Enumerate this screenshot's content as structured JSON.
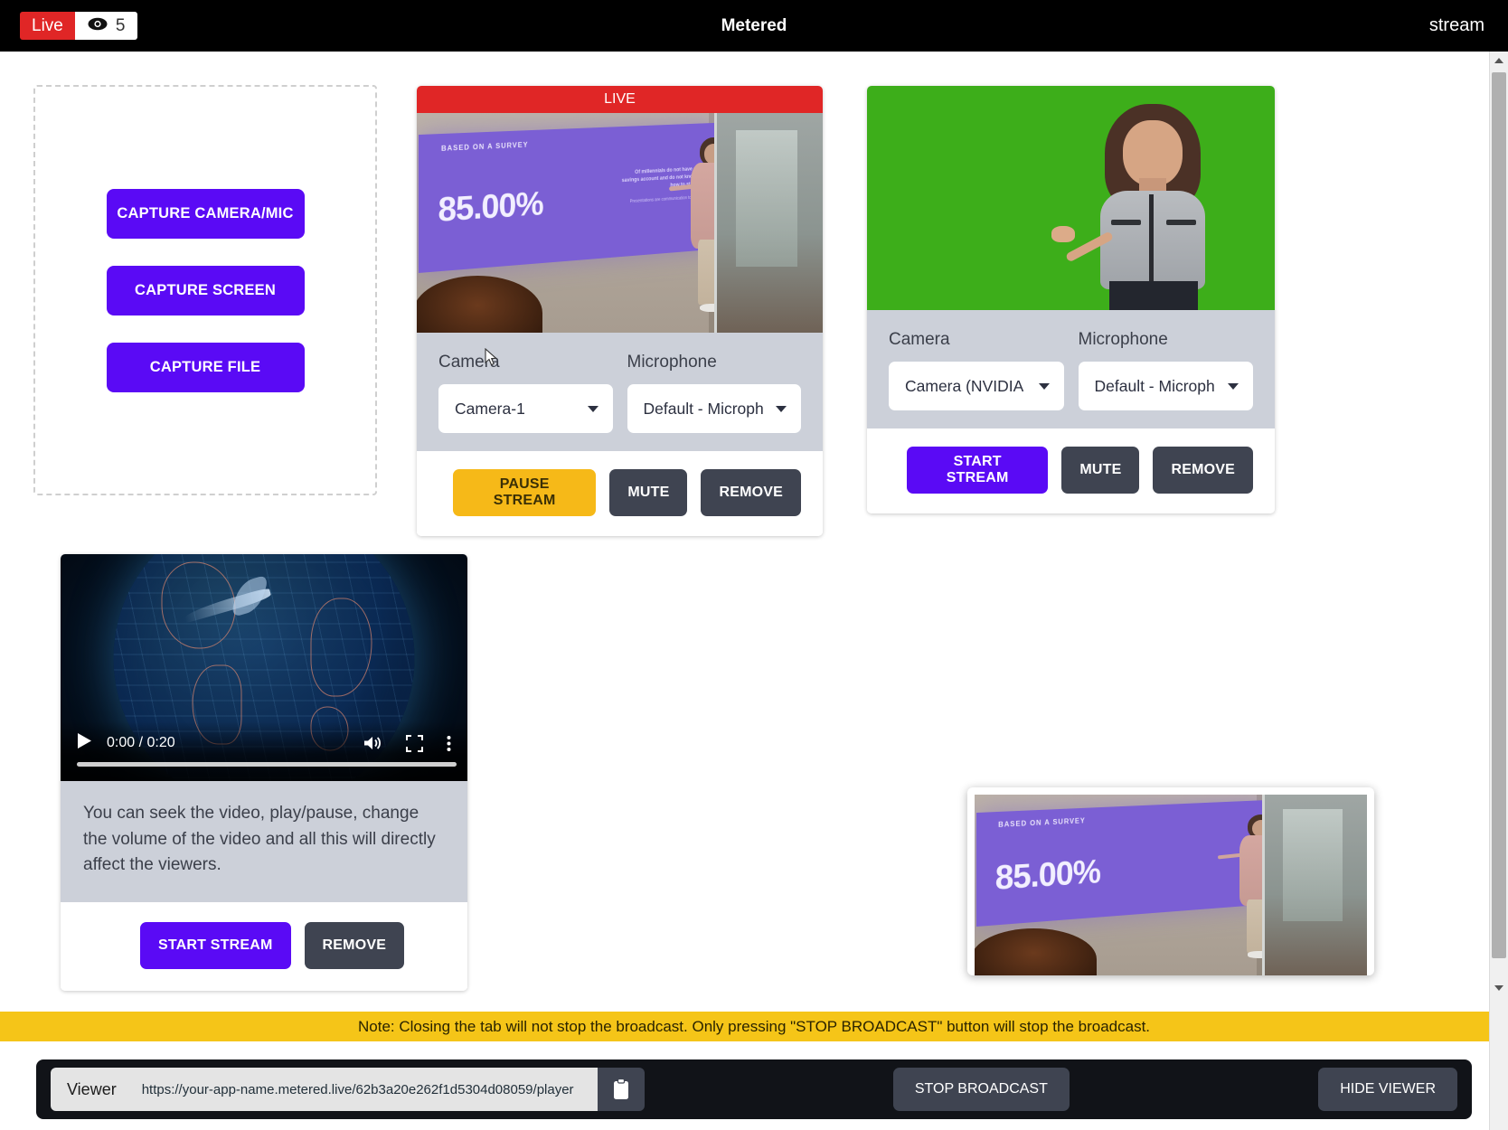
{
  "topbar": {
    "live_label": "Live",
    "viewer_count": "5",
    "eye_icon": "eye-icon",
    "title": "Metered",
    "right_label": "stream"
  },
  "capture_panel": {
    "buttons": [
      {
        "label": "CAPTURE CAMERA/MIC",
        "name": "capture-camera-mic-button"
      },
      {
        "label": "CAPTURE SCREEN",
        "name": "capture-screen-button"
      },
      {
        "label": "CAPTURE FILE",
        "name": "capture-file-button"
      }
    ]
  },
  "stream_camera": {
    "live_badge": "LIVE",
    "camera_label": "Camera",
    "camera_value": "Camera-1",
    "microphone_label": "Microphone",
    "microphone_value": "Default - Microph",
    "actions": {
      "pause": "PAUSE STREAM",
      "mute": "MUTE",
      "remove": "REMOVE"
    },
    "video": {
      "slide_kicker": "BASED ON A SURVEY",
      "slide_big": "85.00%",
      "slide_sub": "Of millennials do not have a savings account and do not know how to start",
      "slide_sub2": "Presentations are communication tools"
    }
  },
  "stream_green": {
    "camera_label": "Camera",
    "camera_value": "Camera (NVIDIA",
    "microphone_label": "Microphone",
    "microphone_value": "Default - Microph",
    "actions": {
      "start": "START STREAM",
      "mute": "MUTE",
      "remove": "REMOVE"
    }
  },
  "stream_file": {
    "player": {
      "play_icon": "play-icon",
      "time": "0:00 / 0:20",
      "volume_icon": "volume-icon",
      "fullscreen_icon": "fullscreen-icon",
      "more_icon": "more-options-icon"
    },
    "description": "You can seek the video, play/pause, change the volume of the video and all this will directly affect the viewers.",
    "actions": {
      "start": "START STREAM",
      "remove": "REMOVE"
    }
  },
  "pip_viewer": {
    "slide_kicker": "BASED ON A SURVEY",
    "slide_big": "85.00%"
  },
  "note_bar": {
    "text": "Note: Closing the tab will not stop the broadcast. Only pressing \"STOP BROADCAST\" button will stop the broadcast."
  },
  "bottom_bar": {
    "viewer_label": "Viewer",
    "viewer_url": "https://your-app-name.metered.live/62b3a20e262f1d5304d08059/player",
    "copy_icon": "clipboard-icon",
    "stop_broadcast": "STOP BROADCAST",
    "hide_viewer": "HIDE VIEWER"
  },
  "colors": {
    "accent_purple": "#5a0af5",
    "live_red": "#e02626",
    "warning_yellow": "#f5c518",
    "dark_button": "#3f4451",
    "pause_yellow": "#f6b918",
    "green_screen": "#3dae1a"
  }
}
